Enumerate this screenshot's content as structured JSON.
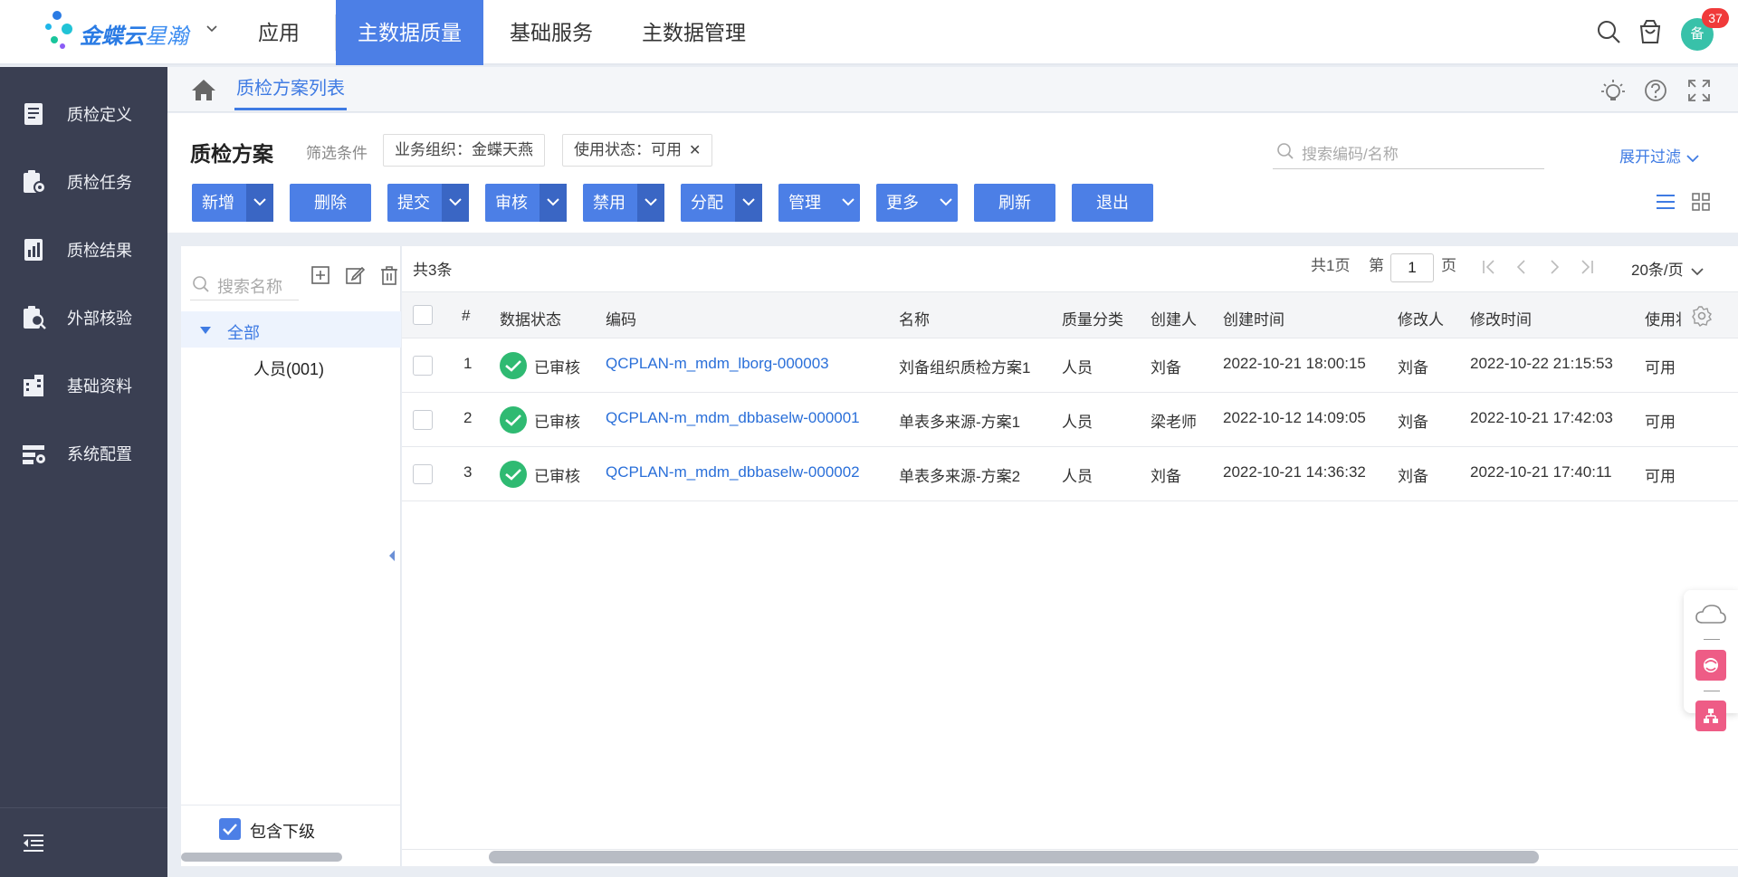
{
  "brand": {
    "name_strong": "金蝶云",
    "name_light": "星瀚"
  },
  "topnav": {
    "items": [
      {
        "label": "应用",
        "active": false
      },
      {
        "label": "主数据质量",
        "active": true
      },
      {
        "label": "基础服务",
        "active": false
      },
      {
        "label": "主数据管理",
        "active": false
      }
    ],
    "avatar_text": "备",
    "notification_count": "37"
  },
  "sidebar": {
    "items": [
      {
        "label": "质检定义",
        "icon": "book-icon"
      },
      {
        "label": "质检任务",
        "icon": "task-icon"
      },
      {
        "label": "质检结果",
        "icon": "result-icon"
      },
      {
        "label": "外部核验",
        "icon": "verify-icon"
      },
      {
        "label": "基础资料",
        "icon": "building-icon"
      },
      {
        "label": "系统配置",
        "icon": "config-icon"
      }
    ]
  },
  "breadcrumb": {
    "tab": "质检方案列表"
  },
  "header": {
    "title": "质检方案",
    "filter_label": "筛选条件",
    "chips": [
      "业务组织：金蝶天燕",
      "使用状态：可用"
    ],
    "search_placeholder": "搜索编码/名称",
    "expand_filter": "展开过滤"
  },
  "toolbar": {
    "buttons": [
      {
        "label": "新增",
        "dropdown": "split"
      },
      {
        "label": "删除",
        "dropdown": "none"
      },
      {
        "label": "提交",
        "dropdown": "split"
      },
      {
        "label": "审核",
        "dropdown": "split"
      },
      {
        "label": "禁用",
        "dropdown": "split"
      },
      {
        "label": "分配",
        "dropdown": "split"
      },
      {
        "label": "管理",
        "dropdown": "inline"
      },
      {
        "label": "更多",
        "dropdown": "inline"
      },
      {
        "label": "刷新",
        "dropdown": "none"
      },
      {
        "label": "退出",
        "dropdown": "none"
      }
    ]
  },
  "tree": {
    "search_placeholder": "搜索名称",
    "root": "全部",
    "children": [
      "人员(001)"
    ],
    "include_sub_label": "包含下级",
    "include_sub_checked": true
  },
  "pager": {
    "total": "共3条",
    "pages": "共1页",
    "page_prefix": "第",
    "page_value": "1",
    "page_suffix": "页",
    "per_page": "20条/页"
  },
  "table": {
    "columns": [
      "#",
      "数据状态",
      "编码",
      "名称",
      "质量分类",
      "创建人",
      "创建时间",
      "修改人",
      "修改时间",
      "使用状"
    ],
    "rows": [
      {
        "index": "1",
        "status": "已审核",
        "code": "QCPLAN-m_mdm_lborg-000003",
        "name": "刘备组织质检方案1",
        "category": "人员",
        "creator": "刘备",
        "created": "2022-10-21 18:00:15",
        "modifier": "刘备",
        "modified": "2022-10-22 21:15:53",
        "use": "可用"
      },
      {
        "index": "2",
        "status": "已审核",
        "code": "QCPLAN-m_mdm_dbbaselw-000001",
        "name": "单表多来源-方案1",
        "category": "人员",
        "creator": "梁老师",
        "created": "2022-10-12 14:09:05",
        "modifier": "刘备",
        "modified": "2022-10-21 17:42:03",
        "use": "可用"
      },
      {
        "index": "3",
        "status": "已审核",
        "code": "QCPLAN-m_mdm_dbbaselw-000002",
        "name": "单表多来源-方案2",
        "category": "人员",
        "creator": "刘备",
        "created": "2022-10-21 14:36:32",
        "modifier": "刘备",
        "modified": "2022-10-21 17:40:11",
        "use": "可用"
      }
    ]
  },
  "colors": {
    "primary": "#4c7fe6",
    "sidebar": "#3a3f52",
    "success": "#2fba72",
    "link": "#2a6fd9",
    "badge": "#f03a3a"
  }
}
